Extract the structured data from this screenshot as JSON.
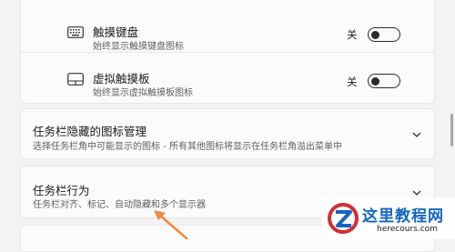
{
  "settings": {
    "touch_keyboard": {
      "title": "触摸键盘",
      "subtitle": "始终显示触摸键盘图标",
      "state": "关",
      "icon": "keyboard-icon"
    },
    "virtual_touchpad": {
      "title": "虚拟触摸板",
      "subtitle": "始终显示虚拟触摸板图标",
      "state": "关",
      "icon": "touchpad-icon"
    },
    "hidden_icons": {
      "title": "任务栏隐藏的图标管理",
      "subtitle": "选择任务栏角中可能显示的图标 - 所有其他图标将显示在任务栏角溢出菜单中"
    },
    "taskbar_behaviors": {
      "title": "任务栏行为",
      "subtitle": "任务栏对齐、标记、自动隐藏和多个显示器"
    }
  },
  "watermark": {
    "title": "这里教程网",
    "url": "herecours.com"
  },
  "colors": {
    "background": "#f3f3f3",
    "card": "#fbfbfb",
    "arrow": "#f08a3c",
    "watermark_blue": "#1565c0",
    "watermark_red": "#d32f2f"
  }
}
